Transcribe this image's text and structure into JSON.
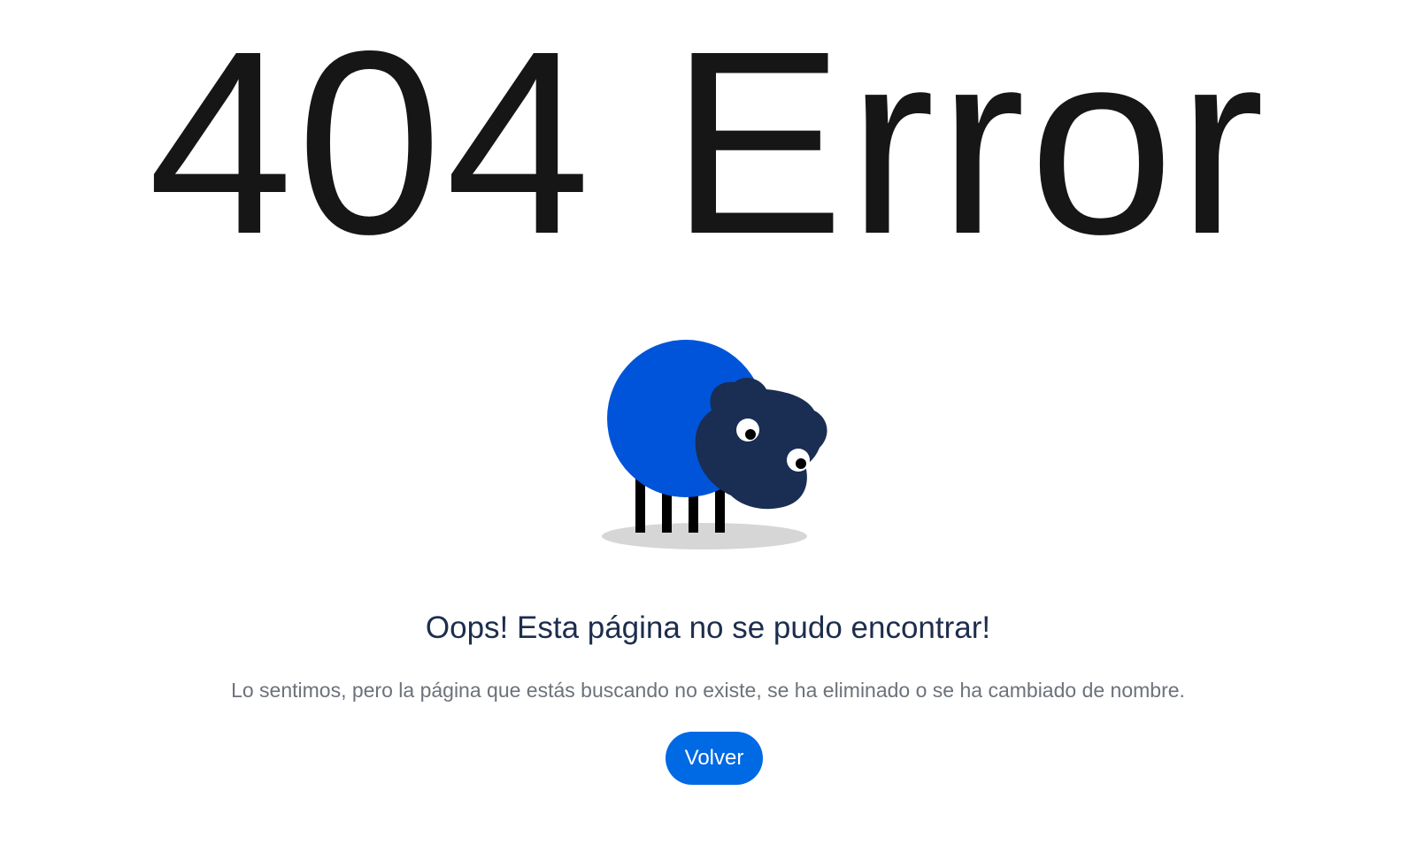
{
  "error": {
    "title": "404 Error",
    "message": "Oops! Esta página no se pudo encontrar!",
    "description": "Lo sentimos, pero la página que estás buscando no existe, se ha eliminado o se ha cambiado de nombre.",
    "back_label": "Volver"
  },
  "illustration": {
    "name": "sheep-illustration",
    "colors": {
      "body": "#0054d9",
      "head": "#1a2d52",
      "legs": "#000000",
      "shadow": "#d6d6d6",
      "eye_white": "#ffffff",
      "pupil": "#000000"
    }
  },
  "colors": {
    "title": "#161616",
    "message": "#1d2d4d",
    "description": "#6c727a",
    "button": "#0069e4",
    "button_text": "#ffffff"
  }
}
